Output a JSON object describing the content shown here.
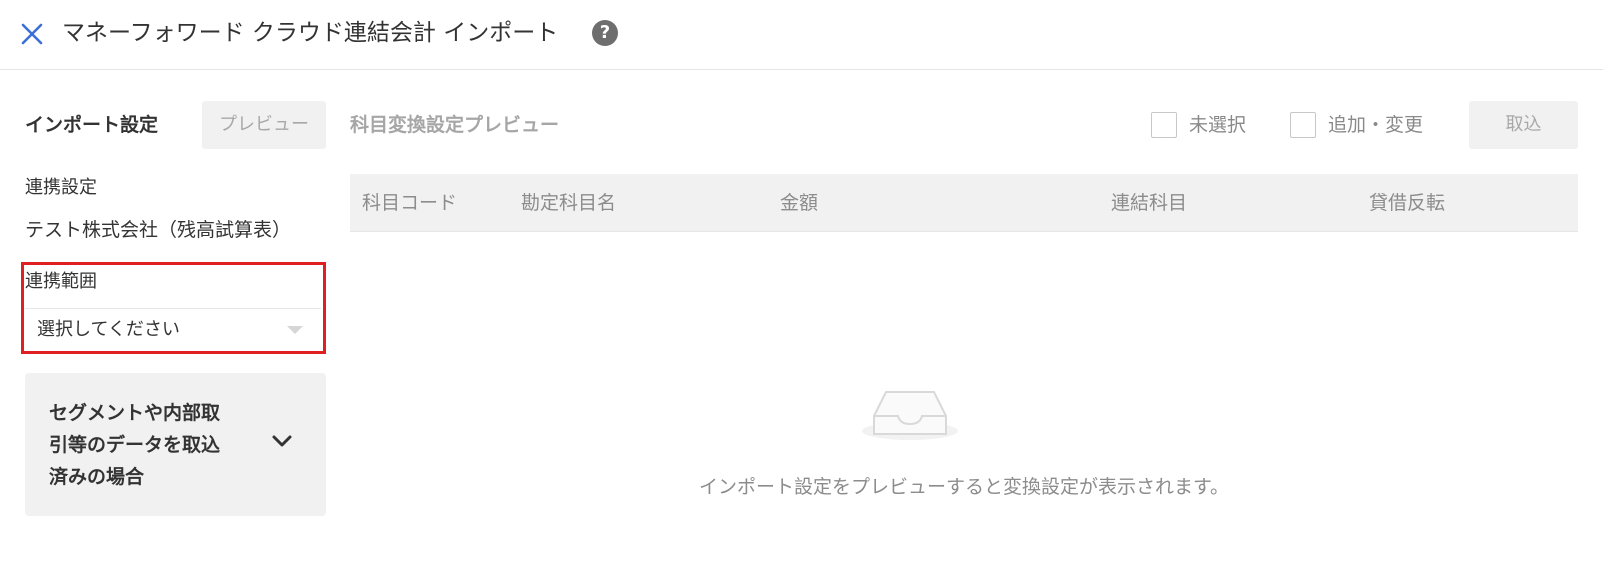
{
  "header": {
    "close_icon": "close-x-icon",
    "title": "マネーフォワード クラウド連結会計 インポート",
    "help_icon_glyph": "?",
    "accent_color": "#3b6fd6"
  },
  "left_panel": {
    "title": "インポート設定",
    "preview_button": "プレビュー",
    "link_settings_label": "連携設定",
    "company_value": "テスト株式会社（残高試算表）",
    "range_label": "連携範囲",
    "range_select_placeholder": "選択してください",
    "range_highlight_color": "#e02020",
    "segment_card_text": "セグメントや内部取\n引等のデータを取込\n済みの場合",
    "segment_card_lines": [
      "セグメントや内部取",
      "引等のデータを取込",
      "済みの場合"
    ],
    "segment_chevron_icon": "chevron-down-icon"
  },
  "right_panel": {
    "title": "科目変換設定プレビュー",
    "checkboxes": [
      {
        "label": "未選択",
        "checked": false
      },
      {
        "label": "追加・変更",
        "checked": false
      }
    ],
    "import_button": "取込",
    "table": {
      "columns": [
        "科目コード",
        "勘定科目名",
        "金額",
        "連結科目",
        "貸借反転"
      ],
      "rows": []
    },
    "empty_icon": "empty-inbox-icon",
    "empty_message": "インポート設定をプレビューすると変換設定が表示されます。"
  }
}
